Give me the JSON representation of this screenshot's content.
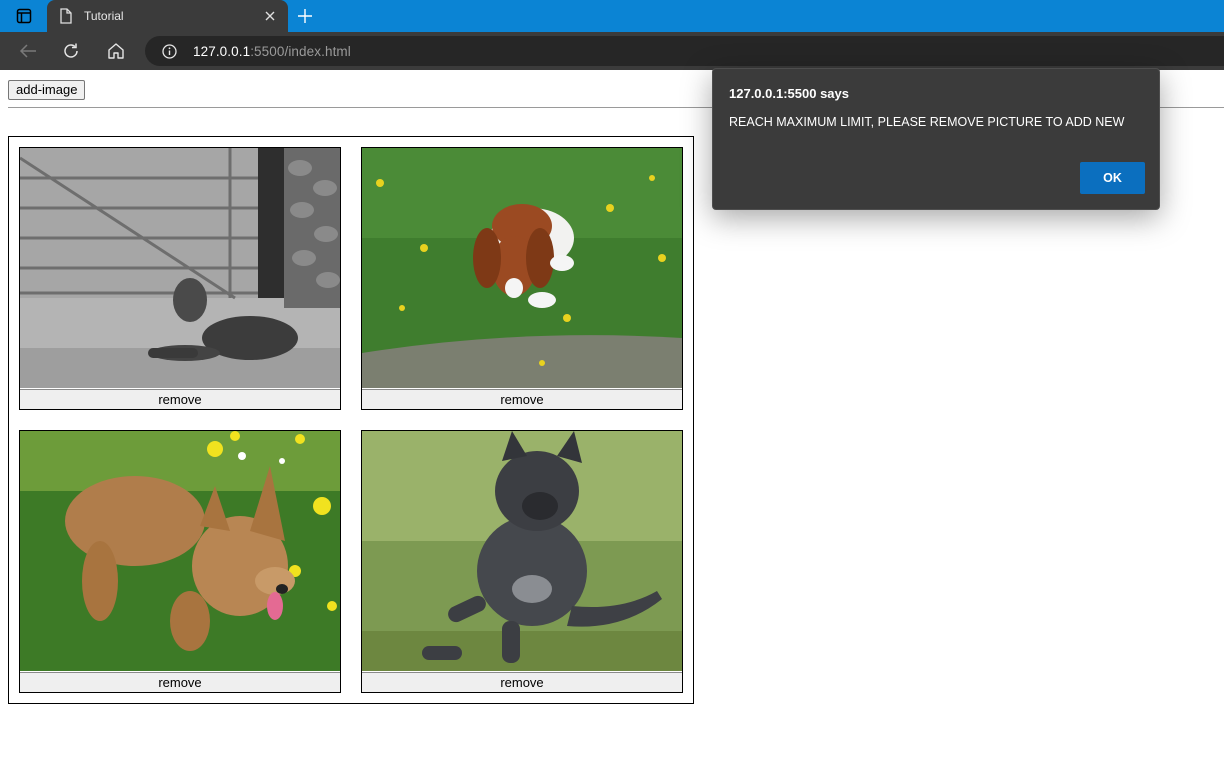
{
  "browser": {
    "tab": {
      "title": "Tutorial"
    },
    "address": {
      "host": "127.0.0.1",
      "rest": ":5500/index.html"
    }
  },
  "page": {
    "add_button_label": "add-image",
    "cards": [
      {
        "image": "gray wolfhound lying by a farm gate (black and white photo)",
        "remove_label": "remove"
      },
      {
        "image": "brown and white spaniel puppy lying in grass",
        "remove_label": "remove"
      },
      {
        "image": "tan terrier playing in grass with dandelions",
        "remove_label": "remove"
      },
      {
        "image": "dark gray shaggy dog running on grass",
        "remove_label": "remove"
      }
    ]
  },
  "dialog": {
    "title": "127.0.0.1:5500 says",
    "message": "REACH MAXIMUM LIMIT, PLEASE REMOVE PICTURE TO ADD NEW",
    "ok_label": "OK"
  },
  "colors": {
    "tabstrip": "#0b84d4",
    "chrome": "#3b3b3b",
    "accent": "#0b6fbf"
  }
}
